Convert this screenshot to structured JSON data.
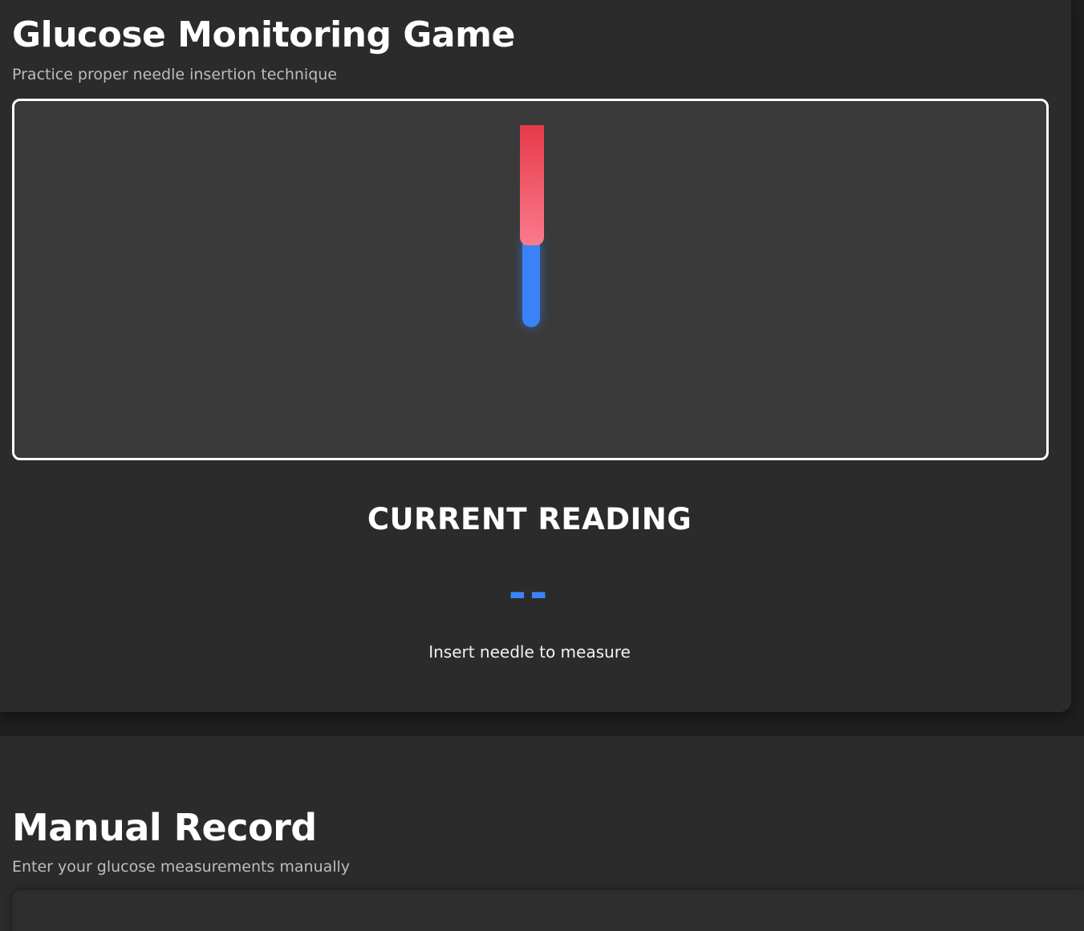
{
  "game": {
    "title": "Glucose Monitoring Game",
    "subtitle": "Practice proper needle insertion technique",
    "reading": {
      "title": "CURRENT READING",
      "value": "--",
      "hint": "Insert needle to measure"
    }
  },
  "manual": {
    "title": "Manual Record",
    "subtitle": "Enter your glucose measurements manually"
  },
  "colors": {
    "accent": "#3b82f6",
    "needle_hub_top": "#e63a4a",
    "needle_hub_bottom": "#fb7a8c",
    "card_bg": "#2b2b2b",
    "play_area_bg": "#3a3a3a"
  },
  "icons": {
    "needle": "needle-icon"
  }
}
